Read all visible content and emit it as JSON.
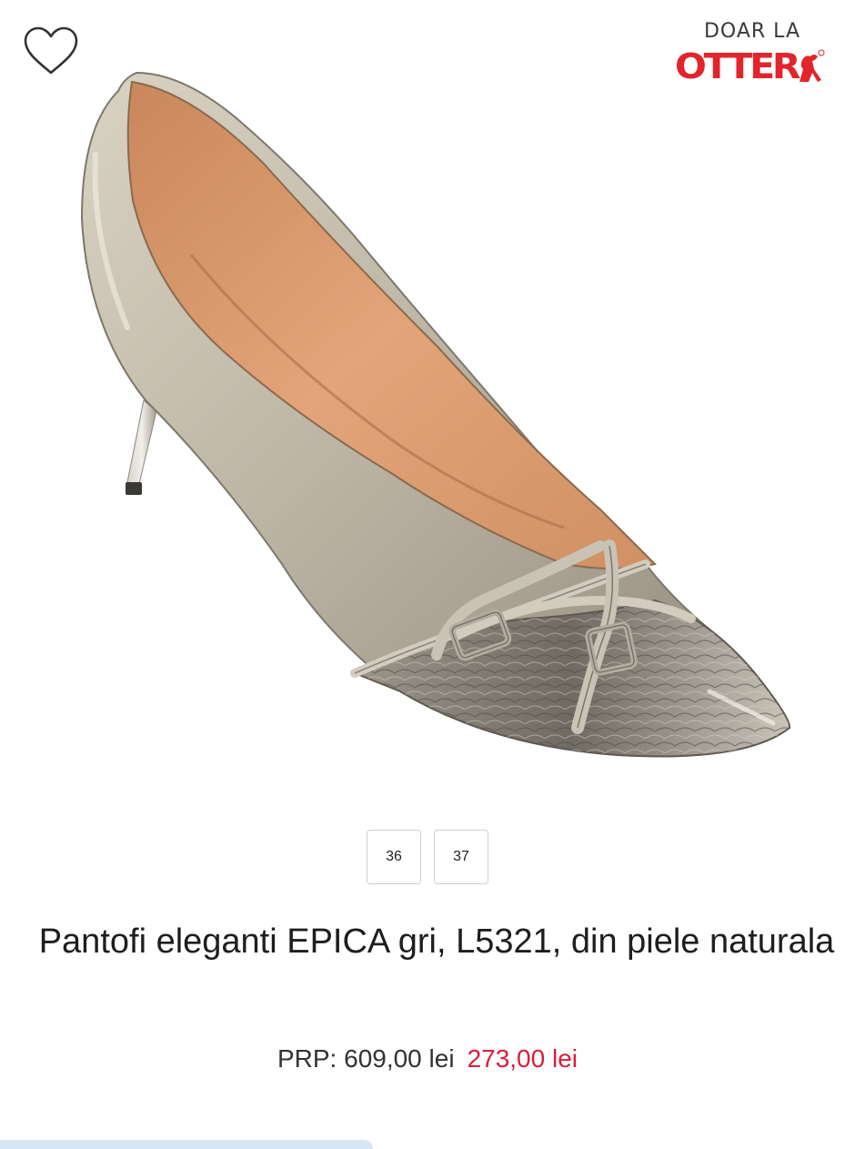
{
  "brand": {
    "tagline": "DOAR LA",
    "logo_text": "OTTER",
    "logo_color": "#e2242c"
  },
  "wishlist": {
    "icon": "heart-outline-icon"
  },
  "product": {
    "image": "silver-pointed-stiletto-pump-photo",
    "sizes": [
      "36",
      "37"
    ],
    "title": "Pantofi eleganti EPICA gri, L5321, din piele naturala",
    "price": {
      "rrp": "PRP: 609,00 lei",
      "sale": "273,00 lei",
      "sale_color": "#d91e3a"
    }
  }
}
